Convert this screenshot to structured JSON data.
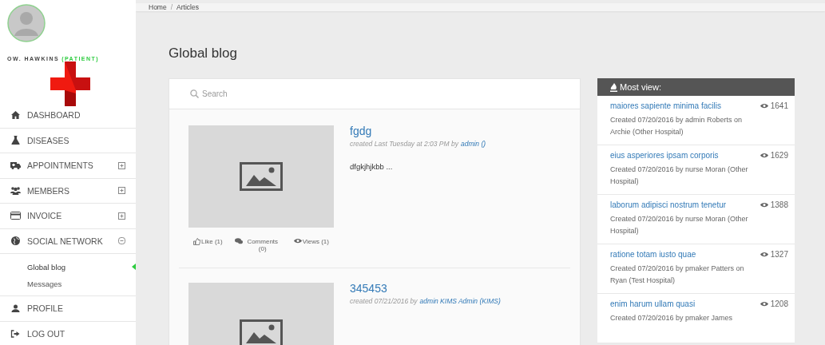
{
  "user": {
    "name": "OW. HAWKINS",
    "role": "(PATIENT)"
  },
  "menu": [
    {
      "label": "DASHBOARD",
      "kind": "link"
    },
    {
      "label": "DISEASES",
      "kind": "link"
    },
    {
      "label": "APPOINTMENTS",
      "kind": "group",
      "expanded": false
    },
    {
      "label": "MEMBERS",
      "kind": "group",
      "expanded": false
    },
    {
      "label": "INVOICE",
      "kind": "group",
      "expanded": false
    },
    {
      "label": "SOCIAL NETWORK",
      "kind": "group",
      "expanded": true,
      "children": [
        {
          "label": "Global blog",
          "selected": true
        },
        {
          "label": "Messages",
          "selected": false
        }
      ]
    },
    {
      "label": "PROFILE",
      "kind": "link"
    },
    {
      "label": "LOG OUT",
      "kind": "link"
    }
  ],
  "breadcrumb": {
    "items": [
      "Home",
      "Articles"
    ],
    "separator": "/"
  },
  "page_title": "Global blog",
  "search": {
    "placeholder": "Search"
  },
  "articles": [
    {
      "title": "fgdg",
      "meta": "created Last Tuesday at 2:03 PM by",
      "author": "admin ()",
      "excerpt": "dfgkjhjkbb ...",
      "like": "Like (1)",
      "comments": "Comments (0)",
      "views": "Views (1)"
    },
    {
      "title": "345453",
      "meta": "created 07/21/2016 by",
      "author": "admin KIMS Admin (KIMS)"
    }
  ],
  "most_viewed": {
    "title": "Most view:",
    "items": [
      {
        "title": "maiores sapiente minima facilis",
        "views": "1641",
        "meta": "Created 07/20/2016 by admin Roberts on Archie (Other Hospital)"
      },
      {
        "title": "eius asperiores ipsam corporis",
        "views": "1629",
        "meta": "Created 07/20/2016 by nurse Moran (Other Hospital)"
      },
      {
        "title": "laborum adipisci nostrum tenetur",
        "views": "1388",
        "meta": "Created 07/20/2016 by nurse Moran (Other Hospital)"
      },
      {
        "title": "ratione totam iusto quae",
        "views": "1327",
        "meta": "Created 07/20/2016 by pmaker Patters on Ryan (Test Hospital)"
      },
      {
        "title": "enim harum ullam quasi",
        "views": "1208",
        "meta": "Created 07/20/2016 by pmaker James"
      }
    ]
  }
}
